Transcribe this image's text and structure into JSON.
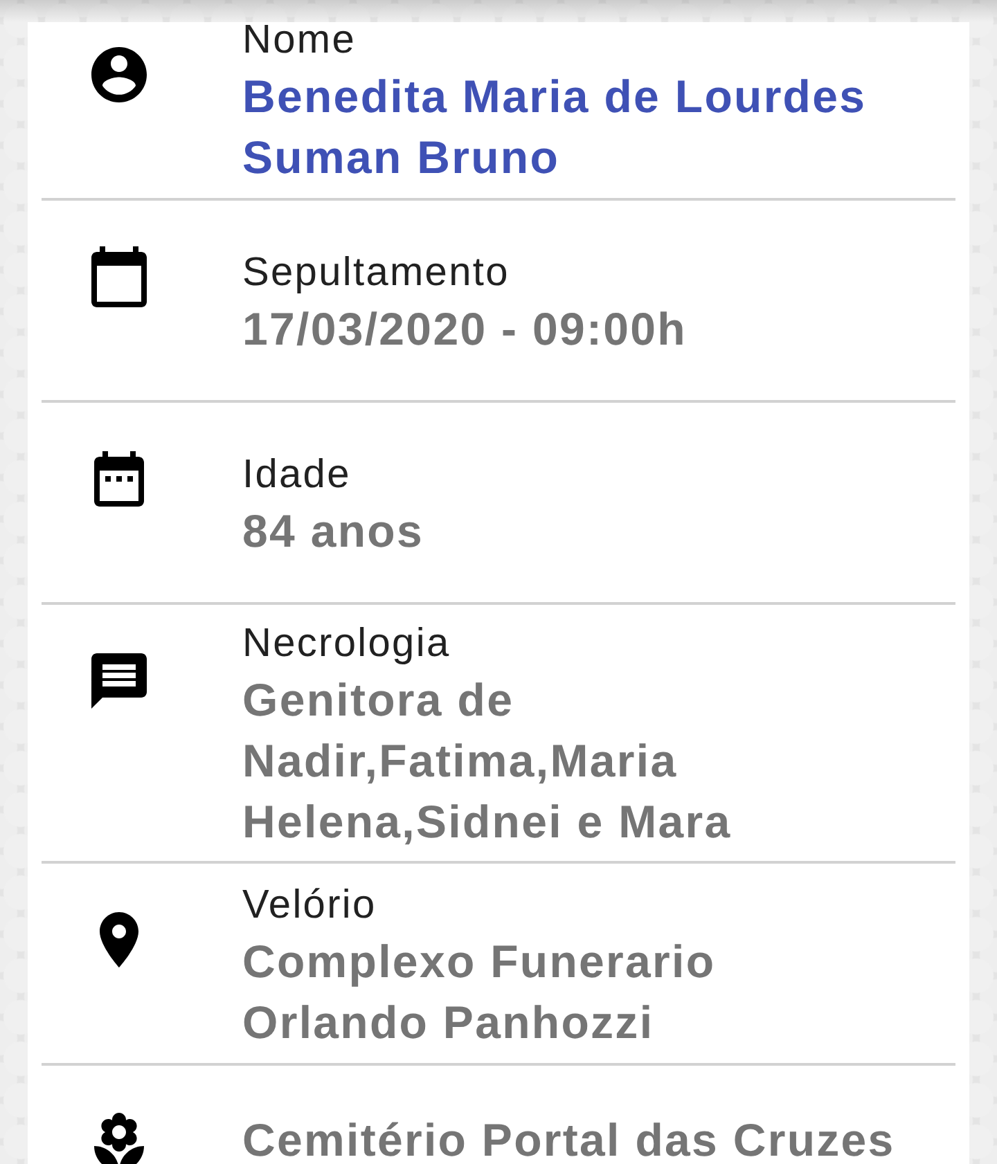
{
  "fields": [
    {
      "kind": "name",
      "label": "Nome",
      "value": "Benedita Maria de Lourdes Suman Bruno"
    },
    {
      "kind": "burial",
      "label": "Sepultamento",
      "value": "17/03/2020 - 09:00h"
    },
    {
      "kind": "age",
      "label": "Idade",
      "value": "84 anos"
    },
    {
      "kind": "obituary",
      "label": "Necrologia",
      "value": "Genitora de Nadir,Fatima,Maria Helena,Sidnei e Mara"
    },
    {
      "kind": "wake",
      "label": "Velório",
      "value": "Complexo Funerario Orlando Panhozzi"
    },
    {
      "kind": "cemetery",
      "value": "Cemitério Portal das Cruzes"
    }
  ]
}
